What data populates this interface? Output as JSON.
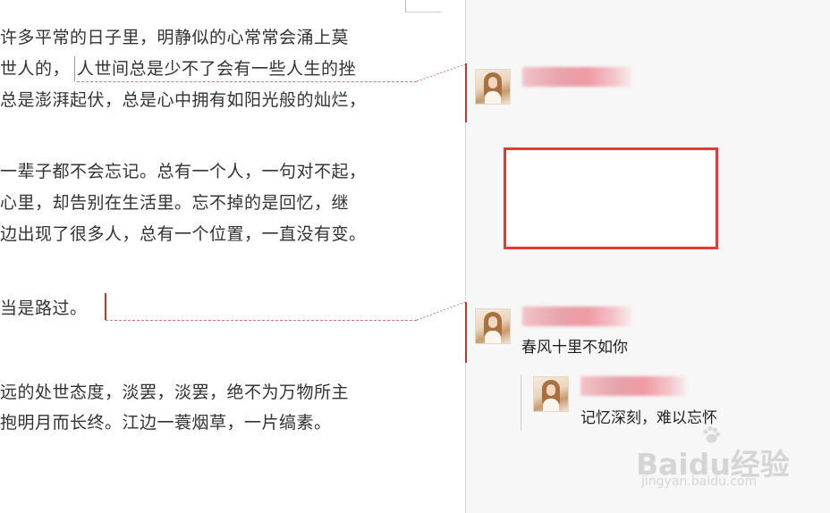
{
  "document": {
    "lines": [
      "许多平常的日子里，明静似的心常常会涌上莫",
      "世人的，",
      "人世间总是少不了会有一些人生的挫",
      "总是澎湃起伏，总是心中拥有如阳光般的灿烂，",
      "一辈子都不会忘记。总有一个人，一句对不起，",
      "心里，却告别在生活里。忘不掉的是回忆，继",
      "边出现了很多人，总有一个位置，一直没有变。",
      "当是路过。",
      "远的处世态度，淡罢，淡罢，绝不为万物所主",
      "抱明月而长终。江边一蓑烟草，一片缟素。"
    ]
  },
  "comments": [
    {
      "author_name": "",
      "text": ""
    },
    {
      "author_name": "",
      "text": "春风十里不如你",
      "replies": [
        {
          "author_name": "",
          "text": "记忆深刻，难以忘怀"
        }
      ]
    }
  ],
  "watermark": {
    "brand": "Baidu经验",
    "url": "jingyan.baidu.com"
  },
  "colors": {
    "comment_accent": "#c0392b",
    "highlight_box": "#e53935",
    "pane_background": "#f7f7f7"
  }
}
